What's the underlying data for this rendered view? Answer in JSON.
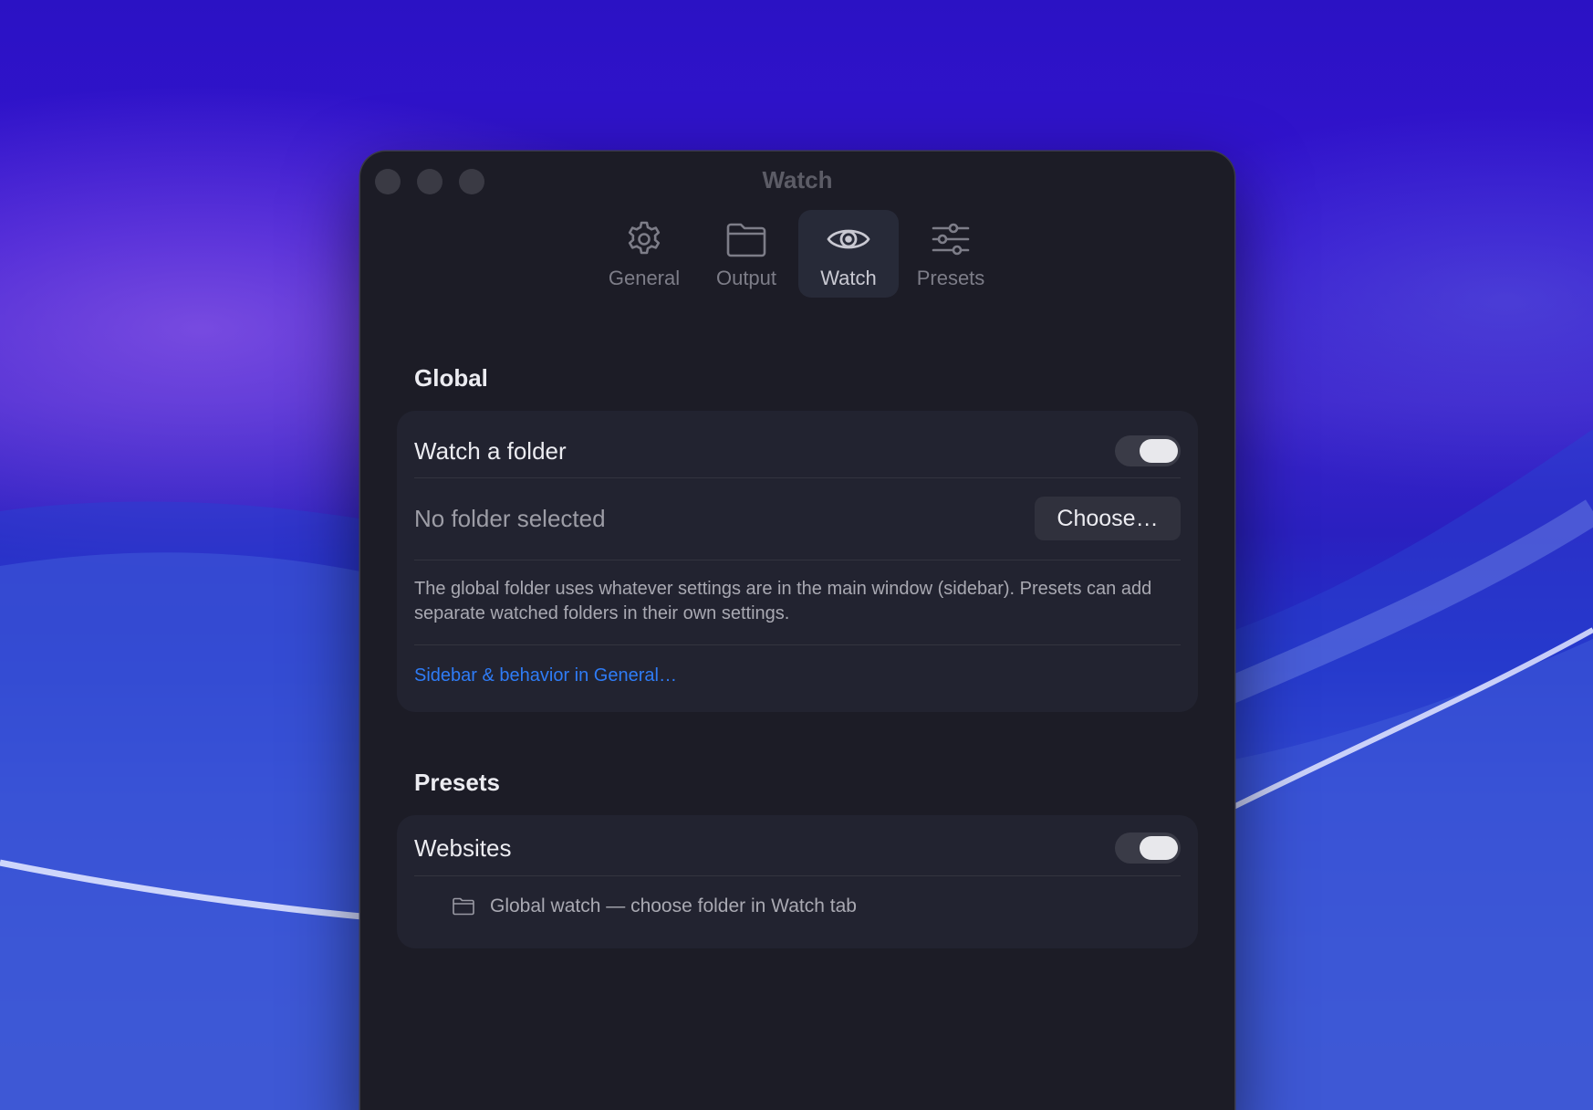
{
  "window": {
    "title": "Watch"
  },
  "tabs": [
    {
      "label": "General",
      "icon": "gear-icon"
    },
    {
      "label": "Output",
      "icon": "folder-icon"
    },
    {
      "label": "Watch",
      "icon": "eye-icon",
      "active": true
    },
    {
      "label": "Presets",
      "icon": "sliders-icon"
    }
  ],
  "global": {
    "title": "Global",
    "watch_folder_label": "Watch a folder",
    "watch_folder_enabled": true,
    "folder_status": "No folder selected",
    "choose_button": "Choose…",
    "description": "The global folder uses whatever settings are in the main window (sidebar). Presets can add separate watched folders in their own settings.",
    "link": "Sidebar & behavior in General…"
  },
  "presets": {
    "title": "Presets",
    "items": [
      {
        "name": "Websites",
        "enabled": true,
        "detail": "Global watch — choose folder in Watch tab"
      }
    ]
  },
  "colors": {
    "window_bg": "#1c1c26",
    "card_bg": "#222330",
    "accent_link": "#2f7cf6",
    "toggle_track": "#3a3b47",
    "toggle_knob": "#e8e8ec"
  }
}
